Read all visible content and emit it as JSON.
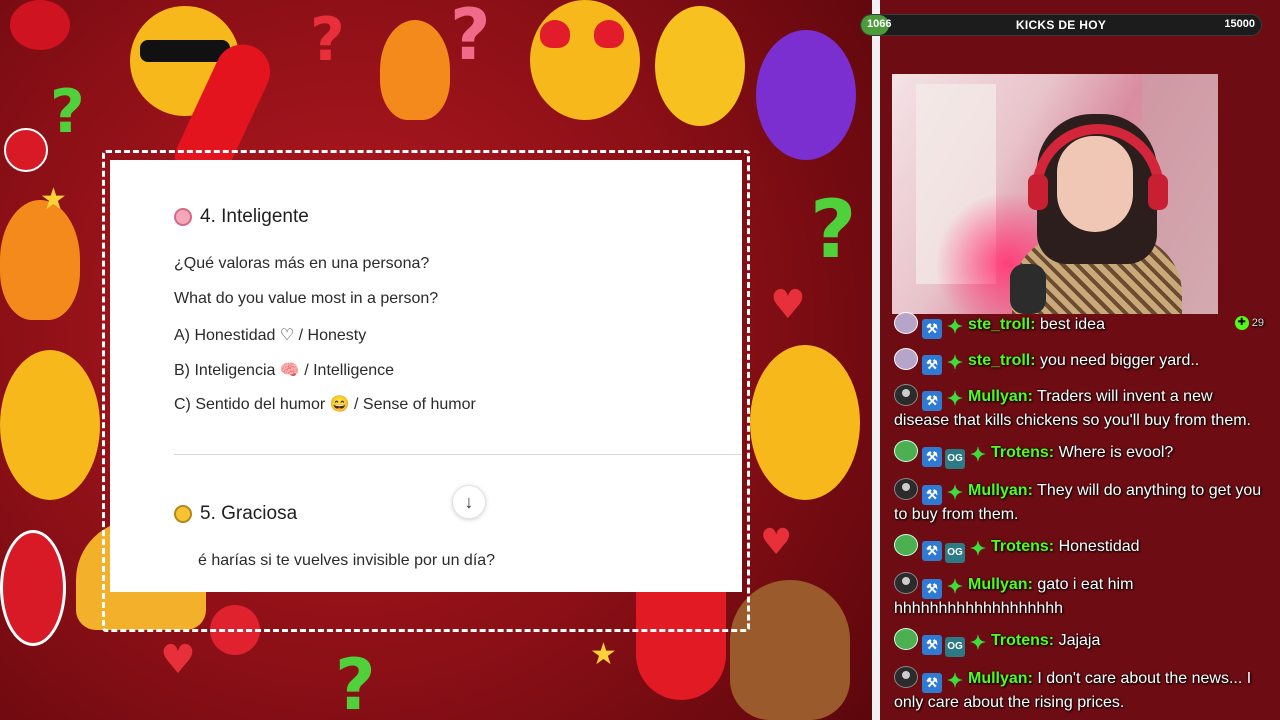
{
  "goal": {
    "current": "1066",
    "title": "KICKS DE HOY",
    "target": "15000",
    "progress_fraction": 0.071,
    "fill_color": "#4b9b3b"
  },
  "document": {
    "sections": [
      {
        "icon": "brain-icon",
        "title": "4. Inteligente",
        "lines": [
          "¿Qué valoras más en una persona?",
          "What do you value most in a person?",
          "A) Honestidad ♡ / Honesty",
          "B) Inteligencia 🧠 / Intelligence",
          "C) Sentido del humor 😄 / Sense of humor"
        ]
      },
      {
        "icon": "lightning-icon",
        "title": "5. Graciosa",
        "lines": [
          "é harías si te vuelves invisible por un día?"
        ]
      }
    ],
    "scroll_down_icon": "arrow-down-icon"
  },
  "chat": {
    "messages": [
      {
        "avatar": "ghost",
        "badges": [
          "mod",
          "sub"
        ],
        "username": "ste_troll:",
        "text": "best idea",
        "likes": "29"
      },
      {
        "avatar": "ghost",
        "badges": [
          "mod",
          "sub"
        ],
        "username": "ste_troll:",
        "text": "you need bigger yard.."
      },
      {
        "avatar": "gray",
        "badges": [
          "mod",
          "sub"
        ],
        "username": "Mullyan:",
        "text": "Traders will invent a new disease that kills chickens so you'll buy from them."
      },
      {
        "avatar": "green",
        "badges": [
          "mod",
          "og",
          "sub"
        ],
        "username": "Trotens:",
        "text": "Where is evool?"
      },
      {
        "avatar": "gray",
        "badges": [
          "mod",
          "sub"
        ],
        "username": "Mullyan:",
        "text": "They will do anything to get you to buy from them."
      },
      {
        "avatar": "green",
        "badges": [
          "mod",
          "og",
          "sub"
        ],
        "username": "Trotens:",
        "text": "Honestidad"
      },
      {
        "avatar": "gray",
        "badges": [
          "mod",
          "sub"
        ],
        "username": "Mullyan:",
        "text": "gato i eat him hhhhhhhhhhhhhhhhhhh"
      },
      {
        "avatar": "green",
        "badges": [
          "mod",
          "og",
          "sub"
        ],
        "username": "Trotens:",
        "text": "Jajaja"
      },
      {
        "avatar": "gray",
        "badges": [
          "mod",
          "sub"
        ],
        "username": "Mullyan:",
        "text": "I don't care about the news... I only care about the rising prices."
      }
    ],
    "username_color": "#53fc18"
  },
  "badge_labels": {
    "og": "OG"
  }
}
